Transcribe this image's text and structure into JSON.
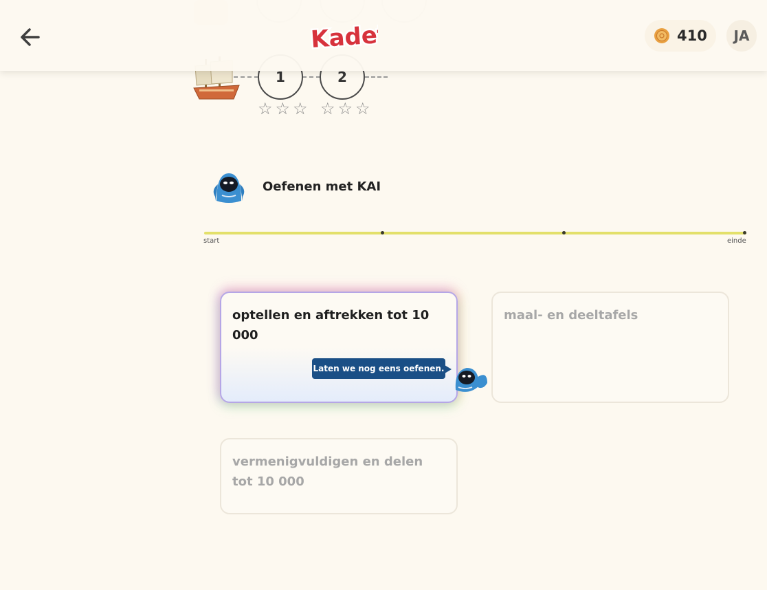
{
  "header": {
    "logo_text": "Kadet",
    "coins": "410",
    "avatar_initials": "JA"
  },
  "levels": [
    {
      "number": "1",
      "stars": [
        "☆",
        "☆",
        "☆"
      ]
    },
    {
      "number": "2",
      "stars": [
        "☆",
        "☆",
        "☆"
      ]
    }
  ],
  "kai": {
    "title": "Oefenen met KAI"
  },
  "progress": {
    "start_label": "start",
    "end_label": "einde"
  },
  "cards": {
    "card1": {
      "title": "optellen en aftrekken tot 10 000",
      "bubble": "Laten we nog eens oefenen."
    },
    "card2": {
      "title": "maal- en deeltafels"
    },
    "card3": {
      "title": "vermenigvuldigen en delen tot 10 000"
    }
  },
  "colors": {
    "background": "#fdf9f0",
    "progress_track": "#e3e06a",
    "bubble": "#1a4f86",
    "robot": "#3b8fd0"
  },
  "icons": [
    "back-arrow-icon",
    "kadet-logo",
    "coin-icon",
    "ship-icon",
    "kai-robot-icon",
    "star-outline-icon"
  ]
}
